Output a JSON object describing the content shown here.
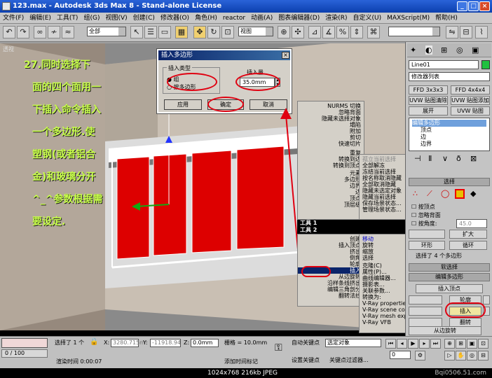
{
  "window": {
    "title": "123.max - Autodesk 3ds Max 8 - Stand-alone License",
    "min": "_",
    "max": "□",
    "close": "×"
  },
  "menu": [
    "文件(F)",
    "编辑(E)",
    "工具(T)",
    "组(G)",
    "视图(V)",
    "创建(C)",
    "修改器(O)",
    "角色(H)",
    "reactor",
    "动画(A)",
    "图表编辑器(D)",
    "渲染(R)",
    "自定义(U)",
    "MAXScript(M)",
    "帮助(H)"
  ],
  "toolbar": {
    "selection_filter": "全部",
    "ref_coord": "视图"
  },
  "viewport": {
    "label": "透视"
  },
  "annotation": {
    "lines": [
      "27.同时选择下",
      "面的四个面用一",
      "下插入命令插入",
      "一个多边形.使",
      "塑钢(或者铝合",
      "金)和玻璃分开",
      "^_^参数根据需",
      "要设定."
    ],
    "colors": {
      "text": "#c8ff4a",
      "accent": "#e00010"
    }
  },
  "dialog": {
    "title": "插入多边形",
    "group_label": "插入类型",
    "radio_group": "组",
    "radio_poly": "按多边形",
    "amount_label": "插入量",
    "amount_value": "35.0mm",
    "apply": "应用",
    "ok": "确定",
    "cancel": "取消"
  },
  "quad_menu": {
    "top_left": [
      "NURMS 切换",
      "忽略背面",
      "隐藏未选择对象",
      "塌陷",
      "附加",
      "剪切",
      "快速切片",
      "重复",
      "转换到边",
      "转换到顶点",
      "元素",
      "多边形",
      "边界",
      "边",
      "顶点",
      "顶层级"
    ],
    "top_right": [
      "孤立当前选择",
      "全部解冻",
      "冻结当前选择",
      "按名称取消隐藏",
      "全部取消隐藏",
      "隐藏未选定对象",
      "隐藏当前选择",
      "保存场景状态...",
      "管理场景状态..."
    ],
    "quadrant_labels": {
      "tools1": "工具 1",
      "display": "显示",
      "tools2": "工具 2",
      "transform": "变换"
    },
    "bottom_left": [
      "创建",
      "插入顶点",
      "挤出",
      "倒角",
      "轮廓",
      "插入",
      "从边旋转",
      "沿样条线挤出",
      "编辑三角剖分",
      "翻转法线"
    ],
    "bottom_right": [
      "移动",
      "旋转",
      "缩放",
      "选择",
      "克隆(C)",
      "属性(P)...",
      "曲线编辑器...",
      "摄影表...",
      "关联参数...",
      "转换为:",
      "V-Ray properties",
      "V-Ray scene converter",
      "V-Ray mesh export",
      "V-Ray VFB"
    ]
  },
  "right_panel": {
    "object_name": "Line01",
    "modifier_list": "修改器列表",
    "btn_ffd333": "FFD 3x3x3",
    "btn_ffd444": "FFD 4x4x4",
    "btn_uvw_clear": "UVW 贴图清除",
    "btn_uvw_add": "UVW 贴图添加",
    "btn_unwrap": "展开",
    "btn_uvw_map": "UVW 贴图",
    "stack": [
      "编辑多边形",
      "顶点",
      "边",
      "边界"
    ],
    "select_head": "选择",
    "by_vertex": "按顶点",
    "ignore_back": "忽略背面",
    "angle_label": "按角度:",
    "angle_value": "45.0",
    "expand": "扩大",
    "ring": "环形",
    "loop": "循环",
    "selected": "选择了 4 个多边形",
    "soft_select": "软选择",
    "edit_poly_head": "编辑多边形",
    "insert_vertex": "插入顶点",
    "outline": "轮廓",
    "inset": "插入",
    "flip": "翻转",
    "hinge": "从边旋转"
  },
  "bottom": {
    "timeline": "0 / 100",
    "selected": "选择了 1 个",
    "x_label": "X:",
    "x_value": "3280.715m",
    "y_label": "Y:",
    "y_value": "-11918.94",
    "z_label": "Z:",
    "z_value": "0.0mm",
    "grid": "栅格 = 10.0mm",
    "auto_key": "自动关键点",
    "selected_obj": "选定对象",
    "set_key": "设置关键点",
    "key_filter": "关键点过滤器...",
    "render_time": "渲染时间 0:00:07",
    "add_tag": "添加时间标记",
    "frame": "0"
  },
  "status": {
    "info": "1024x768  216kb  JPEG",
    "watermark": "Bqi0506.51.com"
  }
}
